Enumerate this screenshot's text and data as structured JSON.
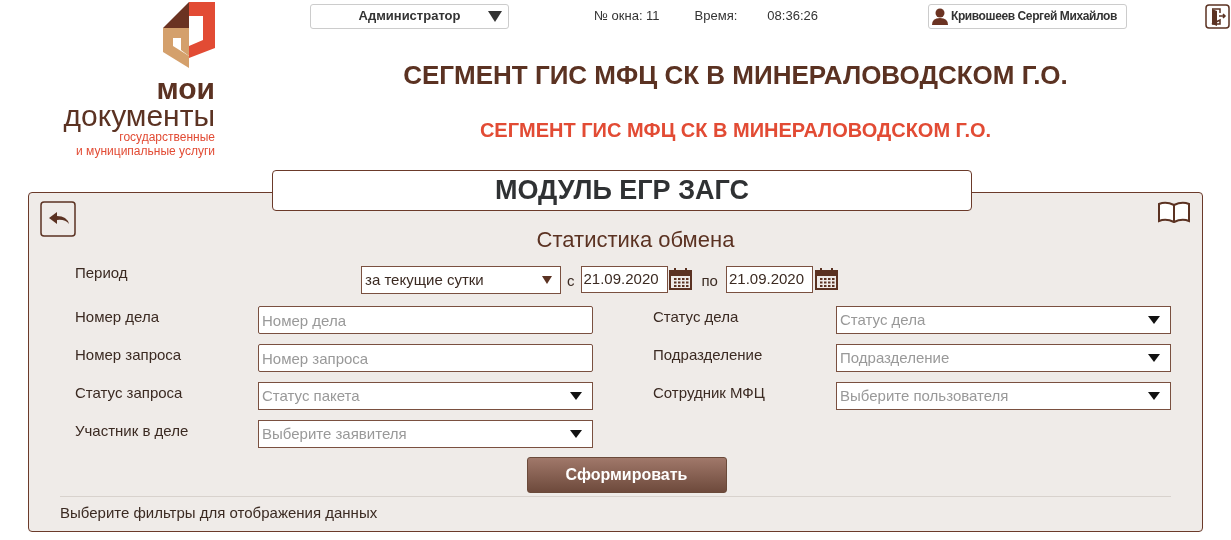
{
  "logo": {
    "line1": "мои",
    "line2": "документы",
    "line3": "государственные",
    "line4": "и муниципальные услуги"
  },
  "top_bar": {
    "role": "Администратор",
    "window_label": "№ окна: 11",
    "time_label": "Время:",
    "time": "08:36:26",
    "user": "Кривошеев Сергей Михайлов"
  },
  "title": "СЕГМЕНТ ГИС МФЦ СК В МИНЕРАЛОВОДСКОМ Г.О.",
  "subtitle": "СЕГМЕНТ ГИС МФЦ СК В МИНЕРАЛОВОДСКОМ Г.О.",
  "module_title": "МОДУЛЬ ЕГР ЗАГС",
  "form_title": "Статистика обмена",
  "period": {
    "label": "Период",
    "value": "за текущие сутки",
    "from_label": "с",
    "from": "21.09.2020",
    "to_label": "по",
    "to": "21.09.2020"
  },
  "left_fields": [
    {
      "label": "Номер дела",
      "kind": "text",
      "placeholder": "Номер дела"
    },
    {
      "label": "Номер запроса",
      "kind": "text",
      "placeholder": "Номер запроса"
    },
    {
      "label": "Статус запроса",
      "kind": "select",
      "placeholder": "Статус пакета"
    },
    {
      "label": "Участник в деле",
      "kind": "select",
      "placeholder": "Выберите заявителя"
    }
  ],
  "right_fields": [
    {
      "label": "Статус дела",
      "kind": "select",
      "placeholder": "Статус дела"
    },
    {
      "label": "Подразделение",
      "kind": "select",
      "placeholder": "Подразделение"
    },
    {
      "label": "Сотрудник МФЦ",
      "kind": "select",
      "placeholder": "Выберите пользователя"
    }
  ],
  "submit": "Сформировать",
  "status": "Выберите фильтры для отображения данных"
}
